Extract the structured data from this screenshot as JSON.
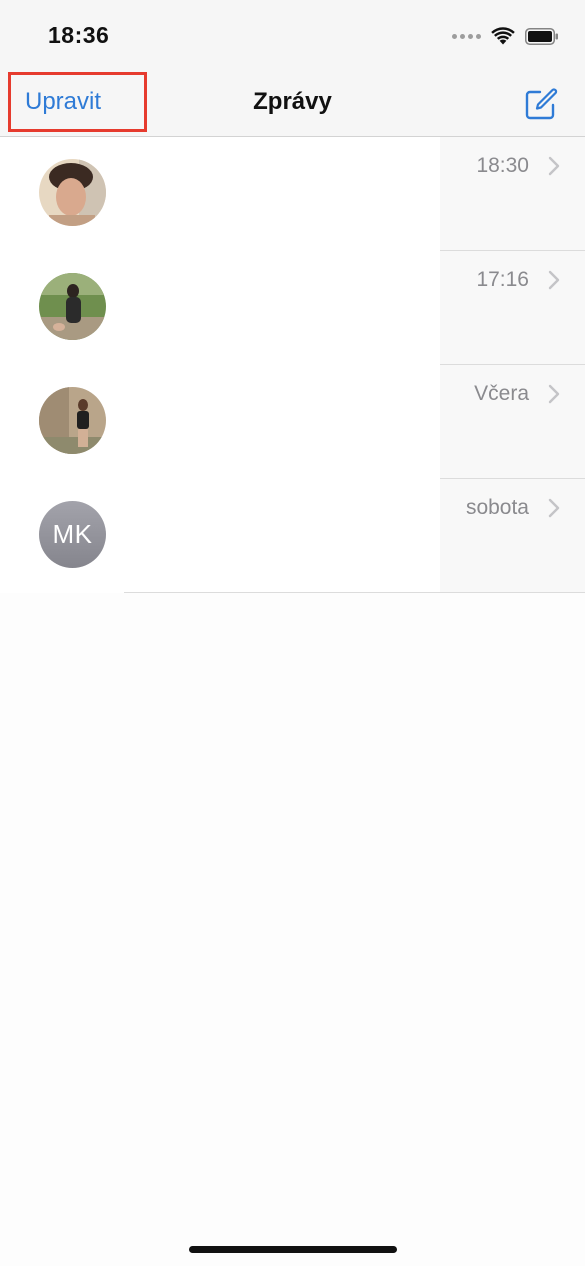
{
  "status_bar": {
    "time": "18:36",
    "icons": [
      "signal-dots-icon",
      "wifi-icon",
      "battery-icon"
    ]
  },
  "nav": {
    "edit_label": "Upravit",
    "title": "Zprávy",
    "compose_icon": "compose-icon",
    "accent_color": "#2f7bd6",
    "highlight_color": "#e63b2e"
  },
  "conversations": [
    {
      "avatar": "photo-avatar",
      "time": "18:30"
    },
    {
      "avatar": "photo-avatar",
      "time": "17:16"
    },
    {
      "avatar": "photo-avatar",
      "time": "Včera"
    },
    {
      "avatar": "initials-avatar",
      "initials": "MK",
      "time": "sobota"
    }
  ]
}
